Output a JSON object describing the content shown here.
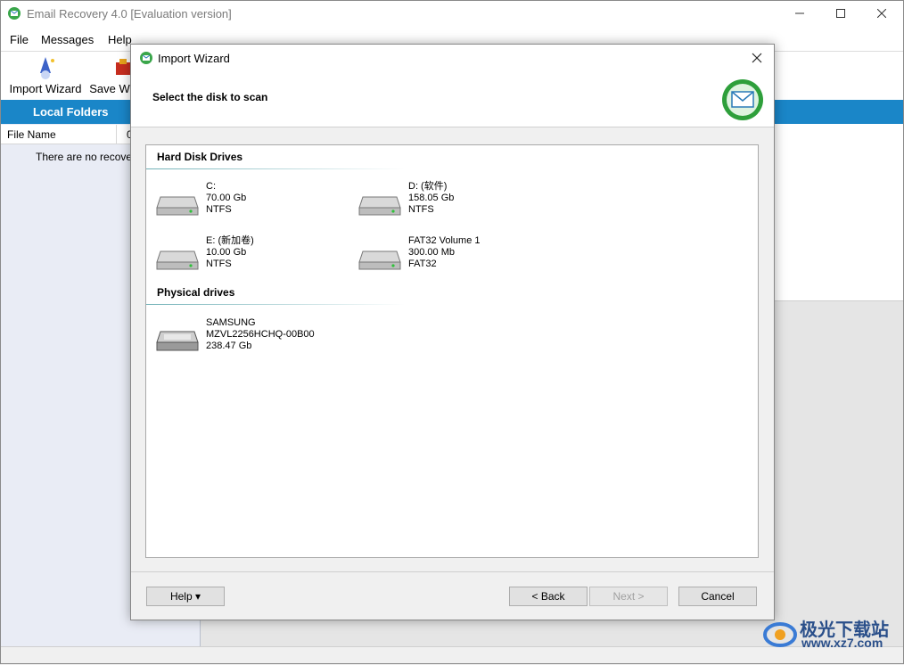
{
  "app": {
    "title": "Email Recovery 4.0 [Evaluation version]",
    "menu": [
      "File",
      "Messages",
      "Help"
    ],
    "toolbar": [
      {
        "label": "Import Wizard",
        "icon": "wizard-icon"
      },
      {
        "label": "Save W",
        "icon": "save-icon"
      }
    ],
    "left_header": "Local Folders",
    "columns": [
      "File Name",
      "0"
    ],
    "empty_message": "There are no recovera"
  },
  "dialog": {
    "title": "Import Wizard",
    "subtitle": "Select the disk to scan",
    "sections": {
      "hard": "Hard Disk Drives",
      "physical": "Physical drives"
    },
    "drives": [
      {
        "name": "C:",
        "size": "70.00 Gb",
        "fs": "NTFS"
      },
      {
        "name": "D: (软件)",
        "size": "158.05 Gb",
        "fs": "NTFS"
      },
      {
        "name": "E: (新加卷)",
        "size": "10.00 Gb",
        "fs": "NTFS"
      },
      {
        "name": "FAT32 Volume 1",
        "size": "300.00 Mb",
        "fs": "FAT32"
      }
    ],
    "physical": [
      {
        "line1": "SAMSUNG",
        "line2": "MZVL2256HCHQ-00B00",
        "line3": "238.47 Gb"
      }
    ],
    "buttons": {
      "help": "Help ▾",
      "back": "< Back",
      "next": "Next >",
      "cancel": "Cancel"
    }
  },
  "watermark": {
    "text": "极光下载站",
    "url": "www.xz7.com"
  },
  "colors": {
    "accent": "#1a86c8",
    "left_pane": "#e9ecf5"
  }
}
